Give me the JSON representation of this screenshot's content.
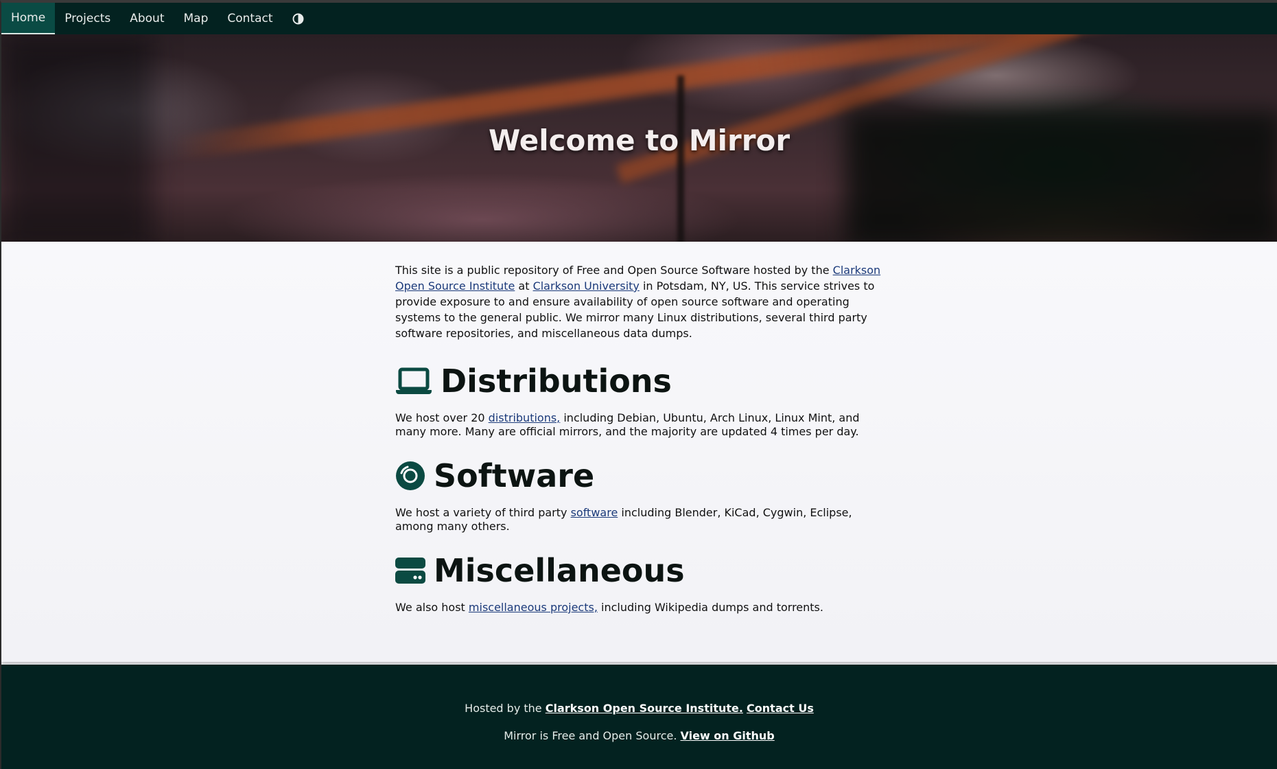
{
  "nav": {
    "items": [
      {
        "label": "Home",
        "active": true
      },
      {
        "label": "Projects",
        "active": false
      },
      {
        "label": "About",
        "active": false
      },
      {
        "label": "Map",
        "active": false
      },
      {
        "label": "Contact",
        "active": false
      }
    ],
    "theme_toggle_icon": "contrast-icon"
  },
  "hero": {
    "title": "Welcome to Mirror"
  },
  "intro": {
    "text_1": "This site is a public repository of Free and Open Source Software hosted by the ",
    "link_cosi": "Clarkson Open Source Institute",
    "text_2": " at ",
    "link_university": "Clarkson University",
    "text_3": " in Potsdam, NY, US. This service strives to provide exposure to and ensure availability of open source software and operating systems to the general public. We mirror many Linux distributions, several third party software repositories, and miscellaneous data dumps."
  },
  "sections": {
    "distributions": {
      "icon": "laptop-icon",
      "title": "Distributions",
      "text_before": "We host over 20 ",
      "link": "distributions,",
      "text_after": " including Debian, Ubuntu, Arch Linux, Linux Mint, and many more. Many are official mirrors, and the majority are updated 4 times per day."
    },
    "software": {
      "icon": "disc-icon",
      "title": "Software",
      "text_before": "We host a variety of third party ",
      "link": "software",
      "text_after": " including Blender, KiCad, Cygwin, Eclipse, among many others."
    },
    "miscellaneous": {
      "icon": "hard-drive-icon",
      "title": "Miscellaneous",
      "text_before": "We also host ",
      "link": "miscellaneous projects,",
      "text_after": " including Wikipedia dumps and torrents."
    }
  },
  "footer": {
    "line1_text": "Hosted by the ",
    "line1_link1": "Clarkson Open Source Institute.",
    "line1_link2": "Contact Us",
    "line2_text": "Mirror is Free and Open Source. ",
    "line2_link": "View on Github"
  },
  "colors": {
    "nav_bg": "#032220",
    "nav_active_bg": "#0a4b44",
    "icon_color": "#0b4a42",
    "link_color": "#1b3a7a",
    "footer_bg": "#032220"
  }
}
